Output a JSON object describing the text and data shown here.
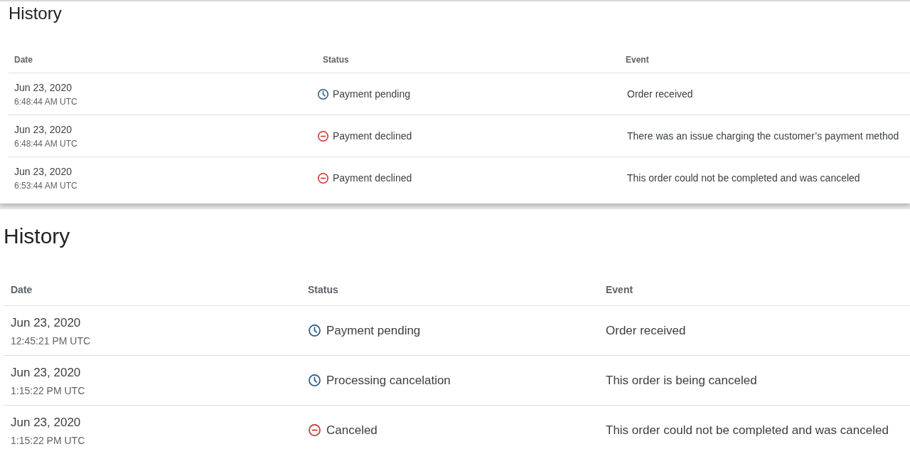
{
  "panels": [
    {
      "title": "History",
      "columns": [
        "Date",
        "Status",
        "Event"
      ],
      "rows": [
        {
          "date": "Jun 23, 2020",
          "time": "6:48:44 AM UTC",
          "status": {
            "kind": "pending",
            "label": "Payment pending"
          },
          "event": "Order received"
        },
        {
          "date": "Jun 23, 2020",
          "time": "6:48:44 AM UTC",
          "status": {
            "kind": "declined",
            "label": "Payment declined"
          },
          "event": "There was an issue charging the customer’s payment method"
        },
        {
          "date": "Jun 23, 2020",
          "time": "6:53:44 AM UTC",
          "status": {
            "kind": "declined",
            "label": "Payment declined"
          },
          "event": "This order could not be completed and was canceled"
        }
      ]
    },
    {
      "title": "History",
      "columns": [
        "Date",
        "Status",
        "Event"
      ],
      "rows": [
        {
          "date": "Jun 23, 2020",
          "time": "12:45:21 PM UTC",
          "status": {
            "kind": "pending",
            "label": "Payment pending"
          },
          "event": "Order received"
        },
        {
          "date": "Jun 23, 2020",
          "time": "1:15:22 PM UTC",
          "status": {
            "kind": "pending",
            "label": "Processing cancelation"
          },
          "event": "This order is being canceled"
        },
        {
          "date": "Jun 23, 2020",
          "time": "1:15:22 PM UTC",
          "status": {
            "kind": "declined",
            "label": "Canceled"
          },
          "event": "This order could not be completed and was canceled"
        }
      ]
    }
  ]
}
